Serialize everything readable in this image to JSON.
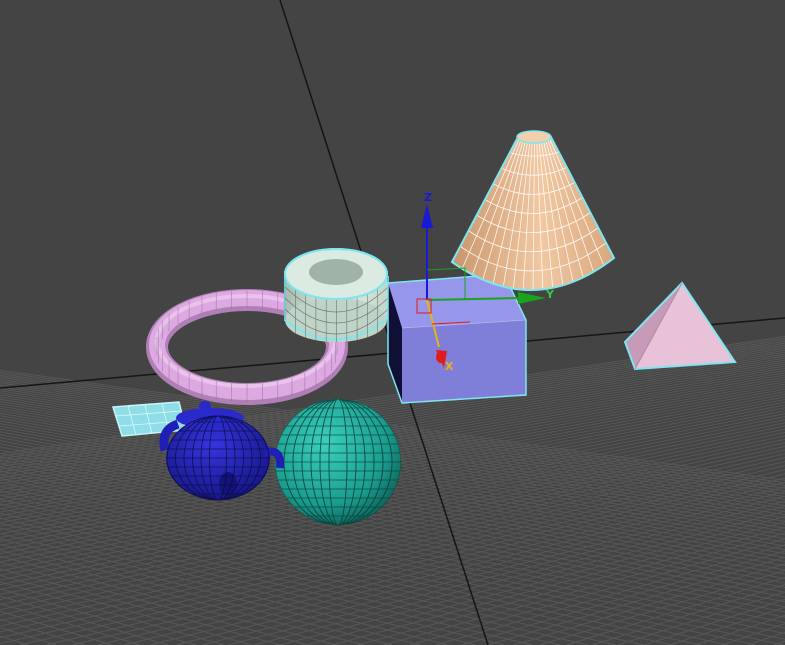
{
  "viewport": {
    "background": "#444444",
    "grid_color": "#575757",
    "grid_major_color": "#1a1a1a",
    "selection_outline": "#7fe6f0"
  },
  "gizmo": {
    "x_label": "X",
    "y_label": "Y",
    "z_label": "Z",
    "x_color": "#e11b1b",
    "y_color": "#1aa31a",
    "z_color": "#1a1ad6"
  },
  "objects": [
    {
      "name": "cone",
      "color": "#e2b48c",
      "selected": true
    },
    {
      "name": "tube",
      "color": "#d6e8dd",
      "selected": true
    },
    {
      "name": "box",
      "color": "#8585e0",
      "selected": true
    },
    {
      "name": "pyramid",
      "color": "#e8c2d8",
      "selected": true
    },
    {
      "name": "torus",
      "color": "#d9a6dd",
      "selected": false
    },
    {
      "name": "plane",
      "color": "#9fe6ee",
      "selected": true
    },
    {
      "name": "teapot",
      "color": "#1f1fb8",
      "selected": false
    },
    {
      "name": "sphere",
      "color": "#1fa898",
      "selected": false
    }
  ]
}
